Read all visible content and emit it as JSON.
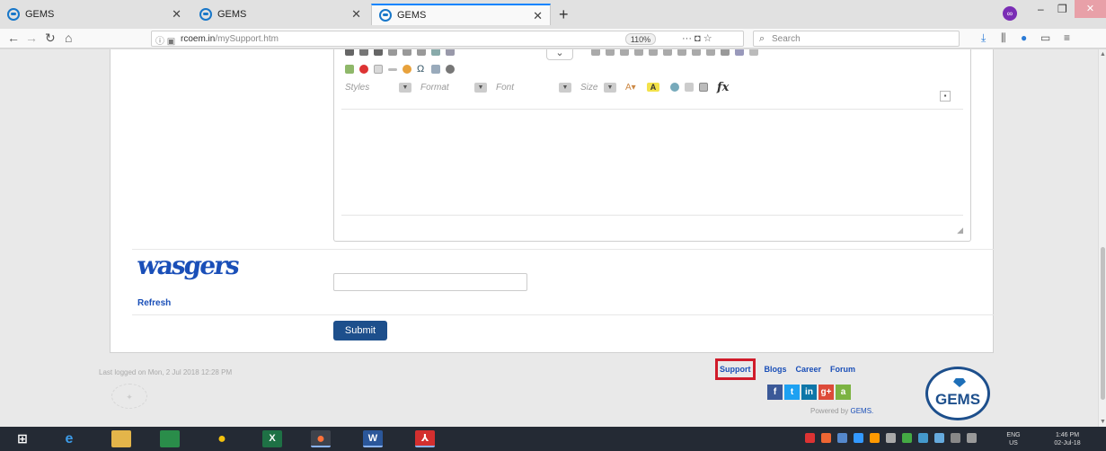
{
  "browser": {
    "tabs": [
      {
        "title": "GEMS",
        "active": false
      },
      {
        "title": "GEMS",
        "active": false
      },
      {
        "title": "GEMS",
        "active": true
      }
    ],
    "url_host": "rcoem.in",
    "url_path": "/mySupport.htm",
    "zoom": "110%",
    "search_placeholder": "Search"
  },
  "editor": {
    "combos": [
      {
        "label": "Styles"
      },
      {
        "label": "Format"
      },
      {
        "label": "Font"
      },
      {
        "label": "Size"
      }
    ],
    "fx_label": "fx"
  },
  "form": {
    "captcha_text": "wasgers",
    "refresh_label": "Refresh",
    "captcha_value": "",
    "submit_label": "Submit"
  },
  "footer": {
    "last_logged": "Last logged on Mon, 2 Jul 2018 12:28 PM",
    "links": [
      "Support",
      "Blogs",
      "Career",
      "Forum"
    ],
    "social": [
      {
        "name": "facebook",
        "glyph": "f",
        "color": "#3b5998"
      },
      {
        "name": "twitter",
        "glyph": "t",
        "color": "#1da1f2"
      },
      {
        "name": "linkedin",
        "glyph": "in",
        "color": "#0e76a8"
      },
      {
        "name": "google-plus",
        "glyph": "g+",
        "color": "#dd4b39"
      },
      {
        "name": "android",
        "glyph": "a",
        "color": "#7cb342"
      }
    ],
    "powered_prefix": "Powered by ",
    "powered_brand": "GEMS.",
    "logo_text": "GEMS"
  },
  "taskbar": {
    "lang_top": "ENG",
    "lang_bottom": "US",
    "time": "1:46 PM",
    "date": "02-Jul-18"
  }
}
